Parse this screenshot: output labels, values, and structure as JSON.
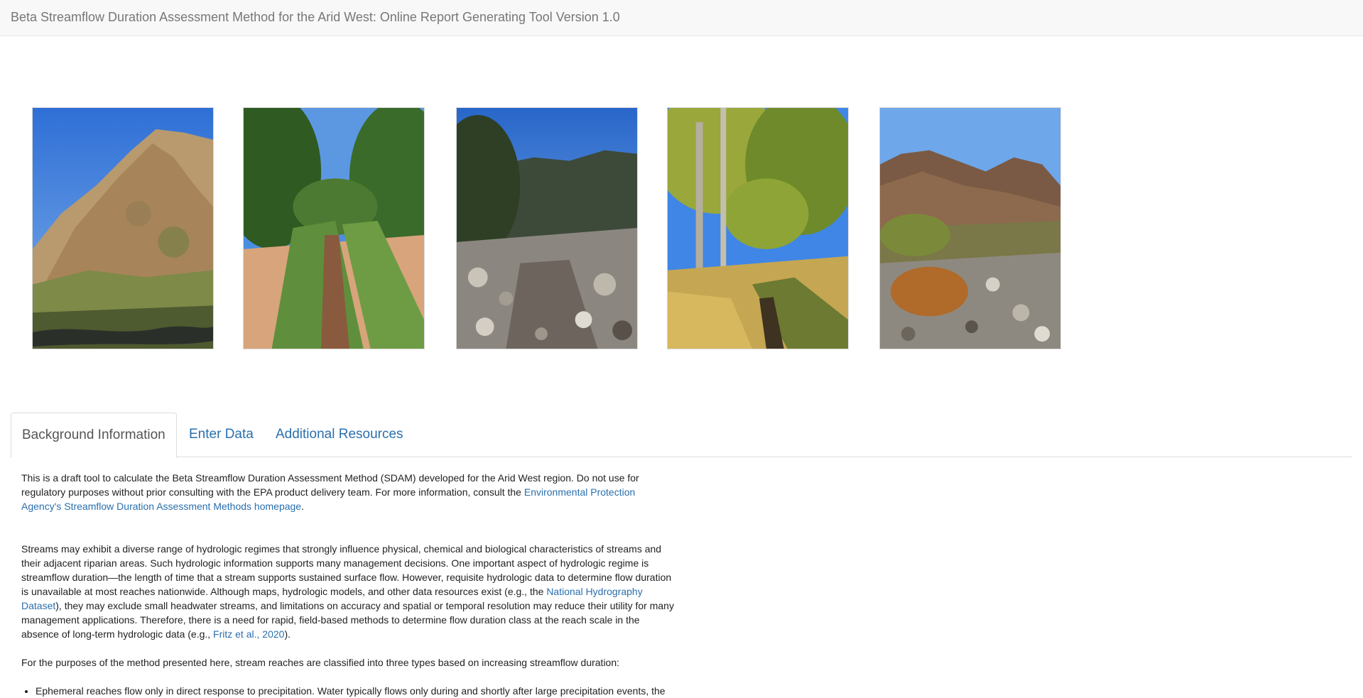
{
  "navbar": {
    "title": "Beta Streamflow Duration Assessment Method for the Arid West: Online Report Generating Tool Version 1.0"
  },
  "gallery": {
    "photos": [
      {
        "icon": "photo-rocky-hillside-stream"
      },
      {
        "icon": "photo-riparian-channel"
      },
      {
        "icon": "photo-rocky-streambed-mountains"
      },
      {
        "icon": "photo-cottonwood-creek"
      },
      {
        "icon": "photo-dry-wash-brown-hills"
      }
    ]
  },
  "tabs": [
    {
      "label": "Background Information",
      "active": true
    },
    {
      "label": "Enter Data",
      "active": false
    },
    {
      "label": "Additional Resources",
      "active": false
    }
  ],
  "content": {
    "p1": {
      "text": "This is a draft tool to calculate the Beta Streamflow Duration Assessment Method (SDAM) developed for the Arid West region. Do not use for regulatory purposes without prior consulting with the EPA product delivery team. For more information, consult the ",
      "link": "Environmental Protection Agency's Streamflow Duration Assessment Methods homepage",
      "end": "."
    },
    "p2": {
      "text_a": "Streams may exhibit a diverse range of hydrologic regimes that strongly influence physical, chemical and biological characteristics of streams and their adjacent riparian areas. Such hydrologic information supports many management decisions. One important aspect of hydrologic regime is streamflow duration—the length of time that a stream supports sustained surface flow. However, requisite hydrologic data to determine flow duration is unavailable at most reaches nationwide. Although maps, hydrologic models, and other data resources exist (e.g., the ",
      "link_a": "National Hydrography Dataset",
      "text_b": "), they may exclude small headwater streams, and limitations on accuracy and spatial or temporal resolution may reduce their utility for many management applications. Therefore, there is a need for rapid, field-based methods to determine flow duration class at the reach scale in the absence of long-term hydrologic data (e.g., ",
      "link_b": "Fritz et al., 2020",
      "text_c": ")."
    },
    "p3": {
      "text": "For the purposes of the method presented here, stream reaches are classified into three types based on increasing streamflow duration:"
    },
    "list": [
      {
        "text": "Ephemeral reaches flow only in direct response to precipitation. Water typically flows only during and shortly after large precipitation events, the"
      }
    ]
  }
}
